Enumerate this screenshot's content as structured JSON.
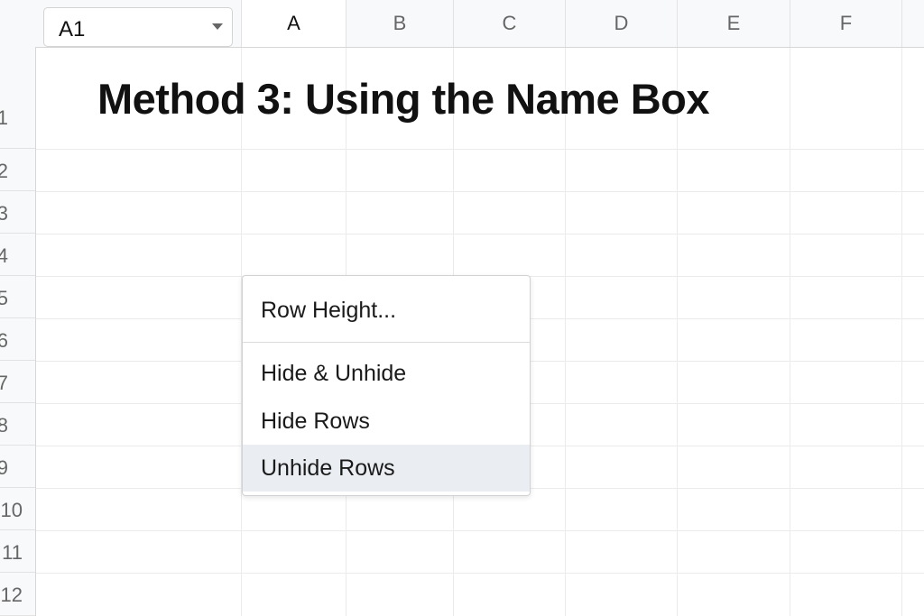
{
  "name_box": {
    "value": "A1",
    "icon": "chevron-down-icon"
  },
  "columns": [
    "A",
    "B",
    "C",
    "D",
    "E",
    "F"
  ],
  "active_column": "A",
  "rows": [
    "1",
    "2",
    "3",
    "4",
    "5",
    "6",
    "7",
    "8",
    "9",
    "10",
    "11",
    "12"
  ],
  "title": "Method 3: Using the Name Box",
  "context_menu": {
    "items": [
      {
        "label": "Row Height..."
      },
      {
        "label": "Hide & Unhide"
      },
      {
        "label": "Hide Rows"
      },
      {
        "label": "Unhide Rows",
        "highlighted": true
      }
    ]
  },
  "colors": {
    "header_bg": "#f8f9fa",
    "grid_line": "#ebebeb",
    "menu_highlight": "#eaeef3"
  }
}
